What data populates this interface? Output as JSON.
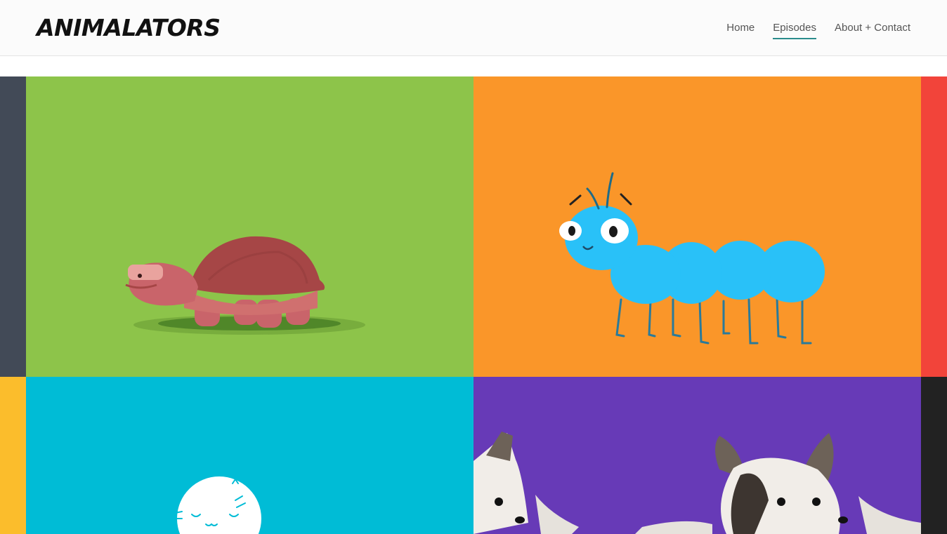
{
  "header": {
    "logo": "ANIMALATORS",
    "nav": [
      {
        "label": "Home",
        "active": false
      },
      {
        "label": "Episodes",
        "active": true
      },
      {
        "label": "About + Contact",
        "active": false
      }
    ]
  },
  "colors": {
    "strip_left_top": "#424a57",
    "strip_right_top": "#f2443a",
    "strip_left_bottom": "#fbbd2c",
    "strip_right_bottom": "#222222",
    "tile_turtle": "#8dc44a",
    "tile_caterpillar": "#fa9629",
    "tile_cat": "#00bcd6",
    "tile_dogs": "#673ab7",
    "nav_active_underline": "#2a8c8c"
  },
  "episodes": [
    {
      "animal": "turtle"
    },
    {
      "animal": "caterpillar"
    },
    {
      "animal": "cat"
    },
    {
      "animal": "dogs"
    }
  ]
}
